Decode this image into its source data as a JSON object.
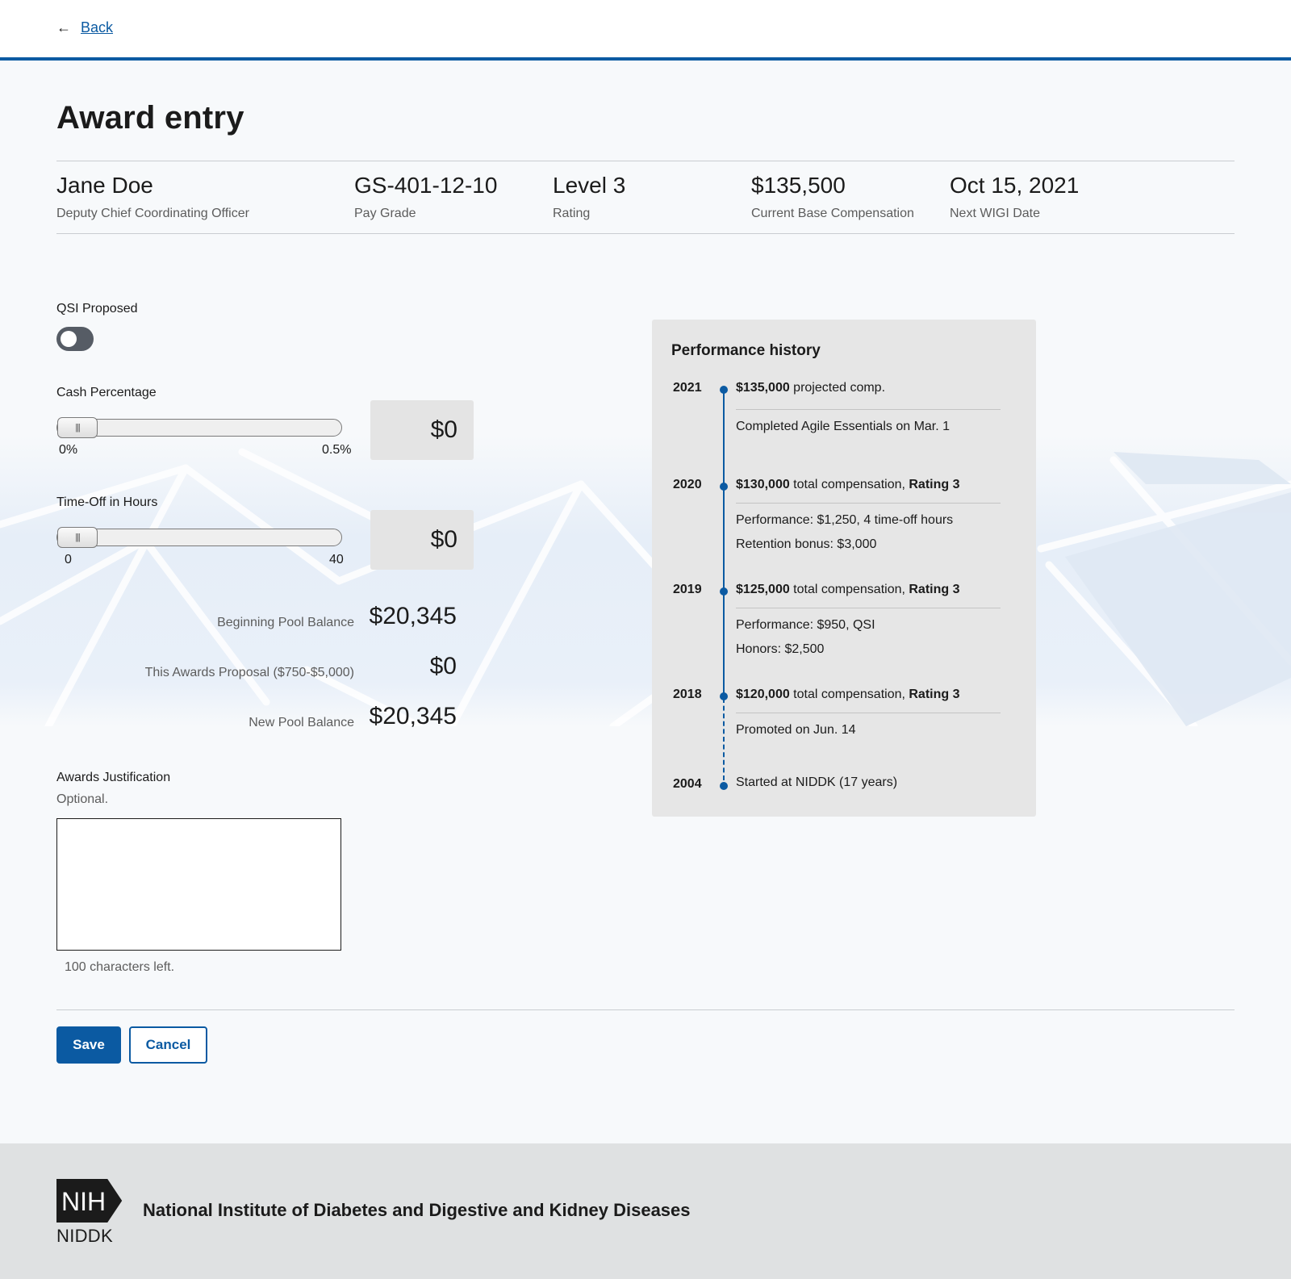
{
  "nav": {
    "back_label": "Back"
  },
  "page": {
    "title": "Award entry"
  },
  "employee": {
    "name": "Jane Doe",
    "position": "Deputy Chief Coordinating Officer",
    "pay_grade": "GS-401-12-10",
    "pay_grade_label": "Pay Grade",
    "rating": "Level 3",
    "rating_label": "Rating",
    "base_comp": "$135,500",
    "base_comp_label": "Current Base Compensation",
    "wigi_date": "Oct 15, 2021",
    "wigi_label": "Next WIGI Date"
  },
  "form": {
    "qsi_label": "QSI Proposed",
    "qsi_on": false,
    "cash_label": "Cash Percentage",
    "cash_min": "0%",
    "cash_max": "0.5%",
    "cash_value": 0,
    "cash_amount": "$0",
    "timeoff_label": "Time-Off in Hours",
    "timeoff_min": "0",
    "timeoff_max": "40",
    "timeoff_value": 0,
    "timeoff_amount": "$0",
    "pool": {
      "beginning_label": "Beginning Pool Balance",
      "beginning_value": "$20,345",
      "proposal_label": "This Awards Proposal ($750-$5,000)",
      "proposal_value": "$0",
      "new_label": "New Pool Balance",
      "new_value": "$20,345"
    },
    "justification_label": "Awards Justification",
    "justification_hint": "Optional.",
    "justification_value": "",
    "chars_left": "100 characters left.",
    "save_label": "Save",
    "cancel_label": "Cancel"
  },
  "performance": {
    "title": "Performance history",
    "entries": [
      {
        "year": "2021",
        "main_bold": "$135,000",
        "main_text": " projected comp.",
        "rating": "",
        "subs": [
          "Completed Agile Essentials on Mar. 1"
        ]
      },
      {
        "year": "2020",
        "main_bold": "$130,000",
        "main_text": " total compensation, ",
        "rating": "Rating 3",
        "subs": [
          "Performance: $1,250, 4 time-off hours",
          "Retention bonus: $3,000"
        ]
      },
      {
        "year": "2019",
        "main_bold": "$125,000",
        "main_text": " total compensation, ",
        "rating": "Rating 3",
        "subs": [
          "Performance: $950, QSI",
          "Honors: $2,500"
        ]
      },
      {
        "year": "2018",
        "main_bold": "$120,000",
        "main_text": " total compensation, ",
        "rating": "Rating 3",
        "subs": [
          "Promoted on Jun. 14"
        ]
      },
      {
        "year": "2004",
        "main_bold": "",
        "main_text": "Started at NIDDK (17 years)",
        "rating": "",
        "subs": []
      }
    ]
  },
  "footer": {
    "logo_text": "NIH",
    "agency_short": "NIDDK",
    "agency_name": "National Institute of Diabetes and Digestive and Kidney Diseases"
  },
  "colors": {
    "primary": "#0b5aa2",
    "footer_bg": "#dfe1e2",
    "panel_bg": "#e6e6e6"
  }
}
